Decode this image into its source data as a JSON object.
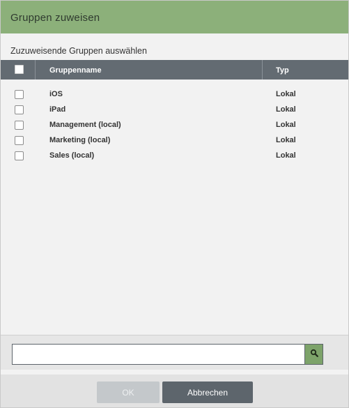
{
  "dialog": {
    "title": "Gruppen zuweisen",
    "section_label": "Zuzuweisende Gruppen auswählen"
  },
  "table": {
    "columns": {
      "name": "Gruppenname",
      "type": "Typ"
    },
    "rows": [
      {
        "name": "iOS",
        "type": "Lokal",
        "checked": false
      },
      {
        "name": "iPad",
        "type": "Lokal",
        "checked": false
      },
      {
        "name": "Management (local)",
        "type": "Lokal",
        "checked": false
      },
      {
        "name": "Marketing (local)",
        "type": "Lokal",
        "checked": false
      },
      {
        "name": "Sales (local)",
        "type": "Lokal",
        "checked": false
      }
    ]
  },
  "search": {
    "value": "",
    "placeholder": "",
    "icon": "search-icon"
  },
  "footer": {
    "ok_label": "OK",
    "cancel_label": "Abbrechen"
  },
  "colors": {
    "titlebar": "#8cb07a",
    "table_header": "#636b72",
    "search_button": "#7da36a",
    "cancel_button": "#5d656c",
    "ok_button_disabled": "#c4c8cb"
  }
}
